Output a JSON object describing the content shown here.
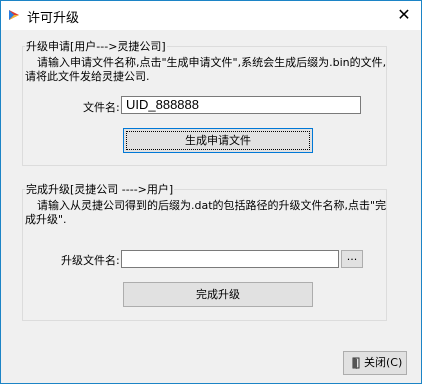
{
  "window": {
    "title": "许可升级",
    "close_glyph": "✕"
  },
  "request_group": {
    "legend": "升级申请[用户--->灵捷公司]",
    "desc_line1": "请输入申请文件名称,点击\"生成申请文件\",系统会生成后缀为.bin的文件,",
    "desc_line2": "请将此文件发给灵捷公司.",
    "filename_label": "文件名:",
    "filename_value": "UID_888888",
    "generate_button": "生成申请文件"
  },
  "complete_group": {
    "legend": "完成升级[灵捷公司 ---->用户]",
    "desc_line1": "请输入从灵捷公司得到的后缀为.dat的包括路径的升级文件名称,点击\"完",
    "desc_line2": "成升级\".",
    "file_label": "升级文件名:",
    "file_value": "",
    "browse_button": "...",
    "complete_button": "完成升级"
  },
  "footer": {
    "close_button": "关闭(C)"
  },
  "icons": {
    "app": "app-logo-icon",
    "close": "close-icon",
    "exit": "exit-door-icon"
  }
}
